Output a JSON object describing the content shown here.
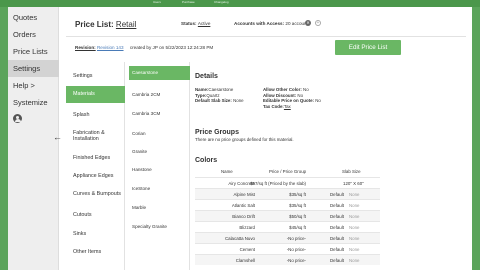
{
  "top_strip": {
    "items": [
      "Users",
      "Purchase",
      "Changelog"
    ]
  },
  "nav": {
    "items": [
      {
        "label": "Quotes"
      },
      {
        "label": "Orders"
      },
      {
        "label": "Price Lists"
      },
      {
        "label": "Settings"
      },
      {
        "label": "Help >"
      },
      {
        "label": "Systemize"
      }
    ],
    "active_index": 3
  },
  "header": {
    "title_label": "Price List:",
    "title_link": "Retail",
    "status_label": "Status:",
    "status_value": "Active",
    "access_label": "Accounts with Access:",
    "access_value": "20 accounts",
    "revision_label": "Revision:",
    "revision_value": "Revision 143",
    "created_by": "created by JP on 5/22/2023 12:24:28 PM",
    "edit_button": "Edit Price List"
  },
  "settings_menu": {
    "items": [
      "Settings",
      "Materials",
      "Splash",
      "Fabrication &",
      "Installation",
      "Finished Edges",
      "Appliance Edges",
      "Curves & Bumpouts",
      "Cutouts",
      "Sinks",
      "Other Items"
    ],
    "active": "Materials"
  },
  "materials": {
    "items": [
      "Caesarstone",
      "Cambria 2CM",
      "Cambria 3CM",
      "Corian",
      "Granite",
      "Hanstone",
      "IceStone",
      "Marble",
      "Specialty Granite"
    ],
    "active": "Caesarstone"
  },
  "details": {
    "title": "Details",
    "name_label": "Name:",
    "name_value": "Caesarstone",
    "type_label": "Type:",
    "type_value": "Quartz",
    "slab_label": "Default Slab Size:",
    "slab_value": "None",
    "allow_other_label": "Allow Other Color:",
    "allow_other_value": "No",
    "allow_discount_label": "Allow Discount:",
    "allow_discount_value": "No",
    "editable_label": "Editable Price on Quote:",
    "editable_value": "No",
    "tax_label": "Tax Code:",
    "tax_value": "Tax"
  },
  "price_groups": {
    "title": "Price Groups",
    "note": "There are no price groups defined for this material."
  },
  "colors": {
    "title": "Colors",
    "headers": [
      "Name",
      "Price / Price Group",
      "Slab Size"
    ],
    "rows": [
      {
        "name": "Airy Concrete",
        "price": "$57/sq ft (Priced by the slab)",
        "slab": "120\" X 60\"",
        "extra": ""
      },
      {
        "name": "Alpine Mist",
        "price": "$35/sq ft",
        "slab": "Default",
        "extra": "None"
      },
      {
        "name": "Atlantic Salt",
        "price": "$35/sq ft",
        "slab": "Default",
        "extra": "None"
      },
      {
        "name": "Bianco Drift",
        "price": "$50/sq ft",
        "slab": "Default",
        "extra": "None"
      },
      {
        "name": "Blizzard",
        "price": "$45/sq ft",
        "slab": "Default",
        "extra": "None"
      },
      {
        "name": "Calacatta Nuvo",
        "price": "-No price-",
        "slab": "Default",
        "extra": "None"
      },
      {
        "name": "Cement",
        "price": "-No price-",
        "slab": "Default",
        "extra": "None"
      },
      {
        "name": "Clamshell",
        "price": "-No price-",
        "slab": "Default",
        "extra": "None"
      }
    ]
  },
  "colors_accent": "#6ab764"
}
